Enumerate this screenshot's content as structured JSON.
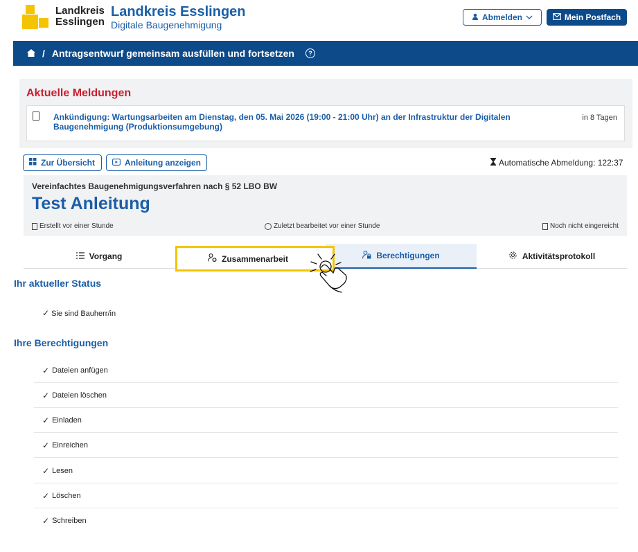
{
  "header": {
    "logo_line1": "Landkreis",
    "logo_line2": "Esslingen",
    "brand_title": "Landkreis Esslingen",
    "brand_sub": "Digitale Baugenehmigung",
    "logout_label": "Abmelden",
    "mailbox_label": "Mein Postfach"
  },
  "breadcrumb": {
    "separator": "/",
    "current": "Antragsentwurf gemeinsam ausfüllen und fortsetzen"
  },
  "news": {
    "title": "Aktuelle Meldungen",
    "item_text": "Ankündigung: Wartungsarbeiten am Dienstag, den 05. Mai 2026 (19:00 - 21:00 Uhr) an der Infrastruktur der Digitalen Baugenehmigung (Produktionsumgebung)",
    "item_time": "in 8 Tagen"
  },
  "actions": {
    "overview_label": "Zur Übersicht",
    "guide_label": "Anleitung anzeigen",
    "auto_logout": "Automatische Abmeldung: 122:37"
  },
  "procedure": {
    "type": "Vereinfachtes Baugenehmigungsverfahren nach § 52 LBO BW",
    "title": "Test Anleitung",
    "created": "Erstellt vor einer Stunde",
    "edited": "Zuletzt bearbeitet vor einer Stunde",
    "submitted": "Noch nicht eingereicht"
  },
  "tabs": [
    {
      "label": "Vorgang",
      "icon": "list-icon"
    },
    {
      "label": "Zusammenarbeit",
      "icon": "user-gear-icon"
    },
    {
      "label": "Berechtigungen",
      "icon": "user-lock-icon",
      "active": true
    },
    {
      "label": "Aktivitätsprotokoll",
      "icon": "gear-icon"
    }
  ],
  "status": {
    "title": "Ihr aktueller Status",
    "item": "Sie sind Bauherr/in"
  },
  "permissions": {
    "title": "Ihre Berechtigungen",
    "items": [
      "Dateien anfügen",
      "Dateien löschen",
      "Einladen",
      "Einreichen",
      "Lesen",
      "Löschen",
      "Schreiben"
    ]
  },
  "colors": {
    "primary": "#1a5ea8",
    "navbar": "#0d4a8a",
    "alert": "#c8202f",
    "highlight": "#f5c400"
  }
}
